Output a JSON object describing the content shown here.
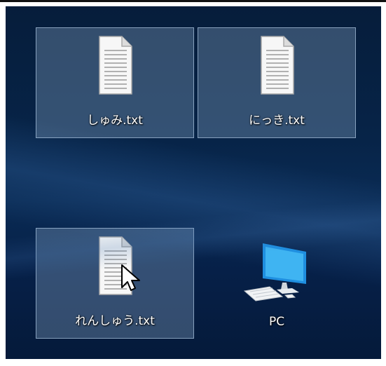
{
  "desktop": {
    "icons": [
      {
        "label": "しゅみ.txt",
        "type": "text-file",
        "selected": true
      },
      {
        "label": "にっき.txt",
        "type": "text-file",
        "selected": true
      },
      {
        "label": "れんしゅう.txt",
        "type": "text-file",
        "selected": true
      },
      {
        "label": "PC",
        "type": "computer",
        "selected": false
      }
    ]
  },
  "colors": {
    "wallpaper": "#072448",
    "selection_fill": "#96b4d2",
    "label_text": "#ffffff",
    "pc_screen": "#2aa0e8"
  },
  "cursor": {
    "icon": "arrow-pointer-icon"
  }
}
